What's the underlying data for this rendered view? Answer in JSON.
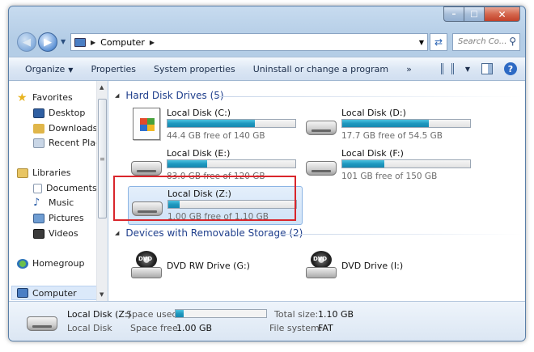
{
  "window": {
    "controls": {
      "minimize": "–",
      "maximize": "□",
      "close": "✕"
    }
  },
  "nav": {
    "back": "◀",
    "forward": "▶",
    "breadcrumb": [
      "Computer"
    ],
    "search_placeholder": "Search Co..."
  },
  "toolbar": {
    "items": [
      {
        "label": "Organize",
        "has_caret": true
      },
      {
        "label": "Properties"
      },
      {
        "label": "System properties"
      },
      {
        "label": "Uninstall or change a program"
      },
      {
        "label": "»"
      }
    ]
  },
  "sidebar": {
    "favorites": {
      "label": "Favorites",
      "items": [
        "Desktop",
        "Downloads",
        "Recent Place"
      ]
    },
    "libraries": {
      "label": "Libraries",
      "items": [
        "Documents",
        "Music",
        "Pictures",
        "Videos"
      ]
    },
    "homegroup": "Homegroup",
    "computer": "Computer"
  },
  "groups": {
    "hdd": {
      "title": "Hard Disk Drives (5)"
    },
    "removable": {
      "title": "Devices with Removable Storage (2)"
    }
  },
  "drives": [
    {
      "label": "Local Disk (C:)",
      "free": "44.4 GB free of 140 GB",
      "used_fraction": 0.683,
      "kind": "system"
    },
    {
      "label": "Local Disk (D:)",
      "free": "17.7 GB free of 54.5 GB",
      "used_fraction": 0.675,
      "kind": "hdd"
    },
    {
      "label": "Local Disk (E:)",
      "free": "83.0 GB free of 120 GB",
      "used_fraction": 0.308,
      "kind": "hdd"
    },
    {
      "label": "Local Disk (F:)",
      "free": "101 GB free of 150 GB",
      "used_fraction": 0.327,
      "kind": "hdd"
    },
    {
      "label": "Local Disk (Z:)",
      "free": "1.00 GB free of 1.10 GB",
      "used_fraction": 0.091,
      "kind": "hdd",
      "selected": true
    }
  ],
  "removable": [
    {
      "label": "DVD RW Drive (G:)",
      "icon_text": "DVD"
    },
    {
      "label": "DVD Drive (I:)",
      "icon_text": "DVD"
    }
  ],
  "details": {
    "name": "Local Disk (Z:)",
    "type": "Local Disk",
    "space_used_label": "Space used:",
    "space_used_fraction": 0.091,
    "space_free_label": "Space free:",
    "space_free": "1.00 GB",
    "total_size_label": "Total size:",
    "total_size": "1.10 GB",
    "file_system_label": "File system:",
    "file_system": "FAT"
  },
  "colors": {
    "accent_bar": "#1f98bf",
    "selection_outline": "#d9262c",
    "group_header": "#1e3e8c"
  }
}
